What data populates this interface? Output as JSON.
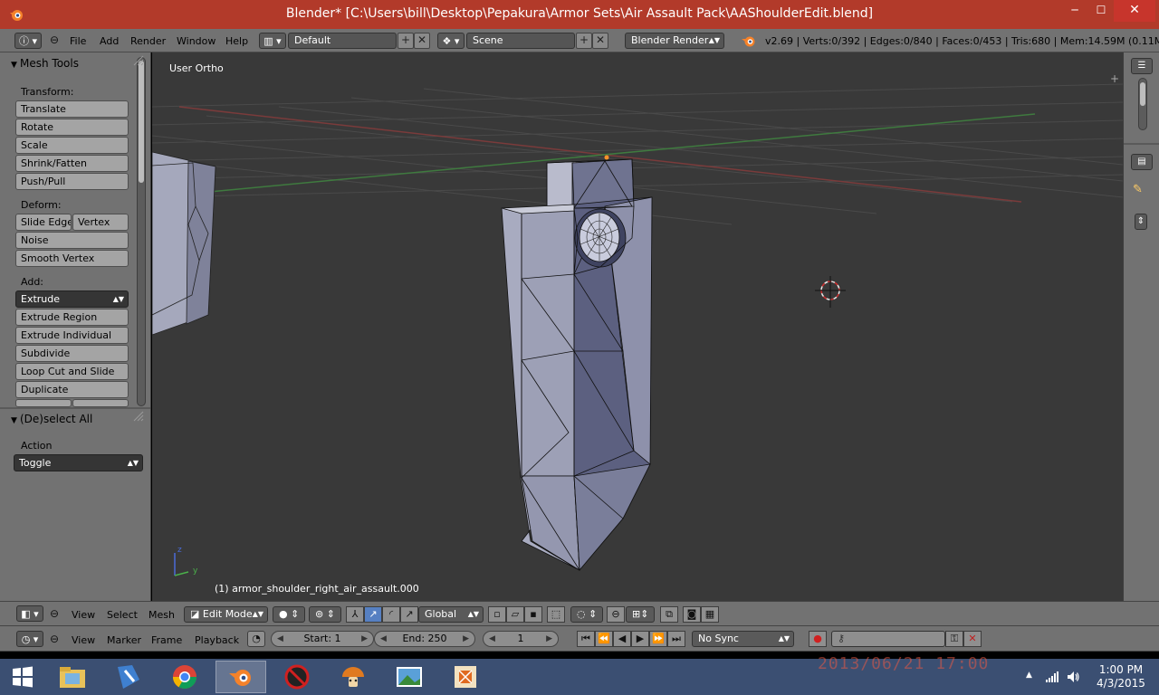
{
  "window": {
    "title": "Blender* [C:\\Users\\bill\\Desktop\\Pepakura\\Armor Sets\\Air Assault Pack\\AAShoulderEdit.blend]",
    "minimize": "─",
    "maximize": "☐",
    "close": "✕"
  },
  "info_header": {
    "menus": [
      "File",
      "Add",
      "Render",
      "Window",
      "Help"
    ],
    "layout": "Default",
    "scene": "Scene",
    "render_engine": "Blender Render",
    "stats": "v2.69 | Verts:0/392 | Edges:0/840 | Faces:0/453 | Tris:680 | Mem:14.59M (0.11M) |"
  },
  "tool_shelf": {
    "mesh_tools_title": "Mesh Tools",
    "transform_label": "Transform:",
    "transform_buttons": [
      "Translate",
      "Rotate",
      "Scale",
      "Shrink/Fatten",
      "Push/Pull"
    ],
    "deform_label": "Deform:",
    "deform_buttons": [
      "Slide Edge",
      "Vertex",
      "Noise",
      "Smooth Vertex"
    ],
    "add_label": "Add:",
    "add_buttons": [
      "Extrude",
      "Extrude Region",
      "Extrude Individual",
      "Subdivide",
      "Loop Cut and Slide",
      "Duplicate"
    ],
    "deselect_title": "(De)select All",
    "action_label": "Action",
    "action_value": "Toggle"
  },
  "viewport": {
    "view_name": "User Ortho",
    "object_label": "(1) armor_shoulder_right_air_assault.000",
    "axis_y": "y",
    "axis_z": "z"
  },
  "view3d_header": {
    "menus": [
      "View",
      "Select",
      "Mesh"
    ],
    "mode": "Edit Mode",
    "orientation": "Global"
  },
  "timeline_header": {
    "menus": [
      "View",
      "Marker",
      "Frame",
      "Playback"
    ],
    "start": "Start: 1",
    "end": "End: 250",
    "current_frame": "1",
    "sync": "No Sync"
  },
  "taskbar": {
    "clock_time": "1:00 PM",
    "clock_date": "4/3/2015",
    "watermark": "2013/06/21 17:00",
    "tray_arrow": "▲"
  },
  "colors": {
    "titlebar": "#b23a2a",
    "panel": "#727272",
    "viewport": "#393939",
    "taskbar": "#3b4f72",
    "selected_button": "#5680c2"
  }
}
